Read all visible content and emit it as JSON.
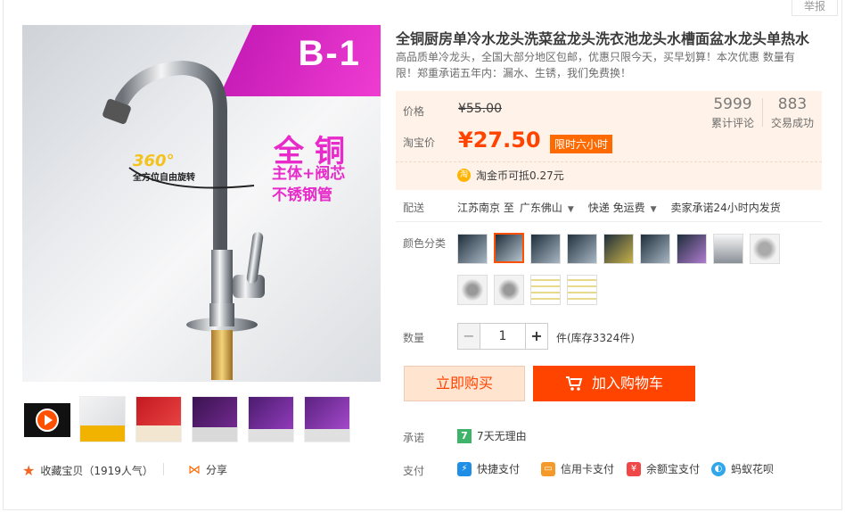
{
  "report": "举报",
  "product": {
    "title": "全铜厨房单冷水龙头洗菜盆龙头洗衣池龙头水槽面盆水龙头单热水",
    "subtitle": "高品质单冷龙头，全国大部分地区包邮，优惠只限今天，买早划算！本次优惠 数量有限！郑重承诺五年内：漏水、生锈，我们免费换！"
  },
  "image": {
    "banner": "B-1",
    "rotate_big": "360°",
    "rotate_small": "全方位自由旋转",
    "promo_line1": "全 铜",
    "promo_line2": "主体+阀芯",
    "promo_line3": "不锈钢管"
  },
  "price": {
    "label": "价格",
    "original": "¥55.00",
    "taobao_label": "淘宝价",
    "current": "¥27.50",
    "tag": "限时六小时",
    "coin_icon": "淘",
    "coin_text": "淘金币可抵0.27元"
  },
  "stats": [
    {
      "value": "5999",
      "label": "累计评论"
    },
    {
      "value": "883",
      "label": "交易成功"
    }
  ],
  "shipping": {
    "label": "配送",
    "from": "江苏南京 至",
    "to": "广东佛山",
    "method": "快递 免运费",
    "promise": "卖家承诺24小时内发货"
  },
  "color": {
    "label": "颜色分类",
    "swatch_count": 14,
    "selected_index": 1
  },
  "quantity": {
    "label": "数量",
    "minus": "−",
    "value": "1",
    "plus": "+",
    "stock": "件(库存3324件)"
  },
  "buttons": {
    "buy": "立即购买",
    "cart": "加入购物车"
  },
  "guarantee": {
    "label": "承诺",
    "icon": "7",
    "text": "7天无理由"
  },
  "payment": {
    "label": "支付",
    "methods": [
      "快捷支付",
      "信用卡支付",
      "余额宝支付",
      "蚂蚁花呗"
    ]
  },
  "actions": {
    "favorite": "收藏宝贝（1919人气）",
    "share": "分享"
  },
  "colors": {
    "accent": "#ff4400",
    "price_bg": "#fff2e8",
    "banner": "#e72ac9"
  }
}
